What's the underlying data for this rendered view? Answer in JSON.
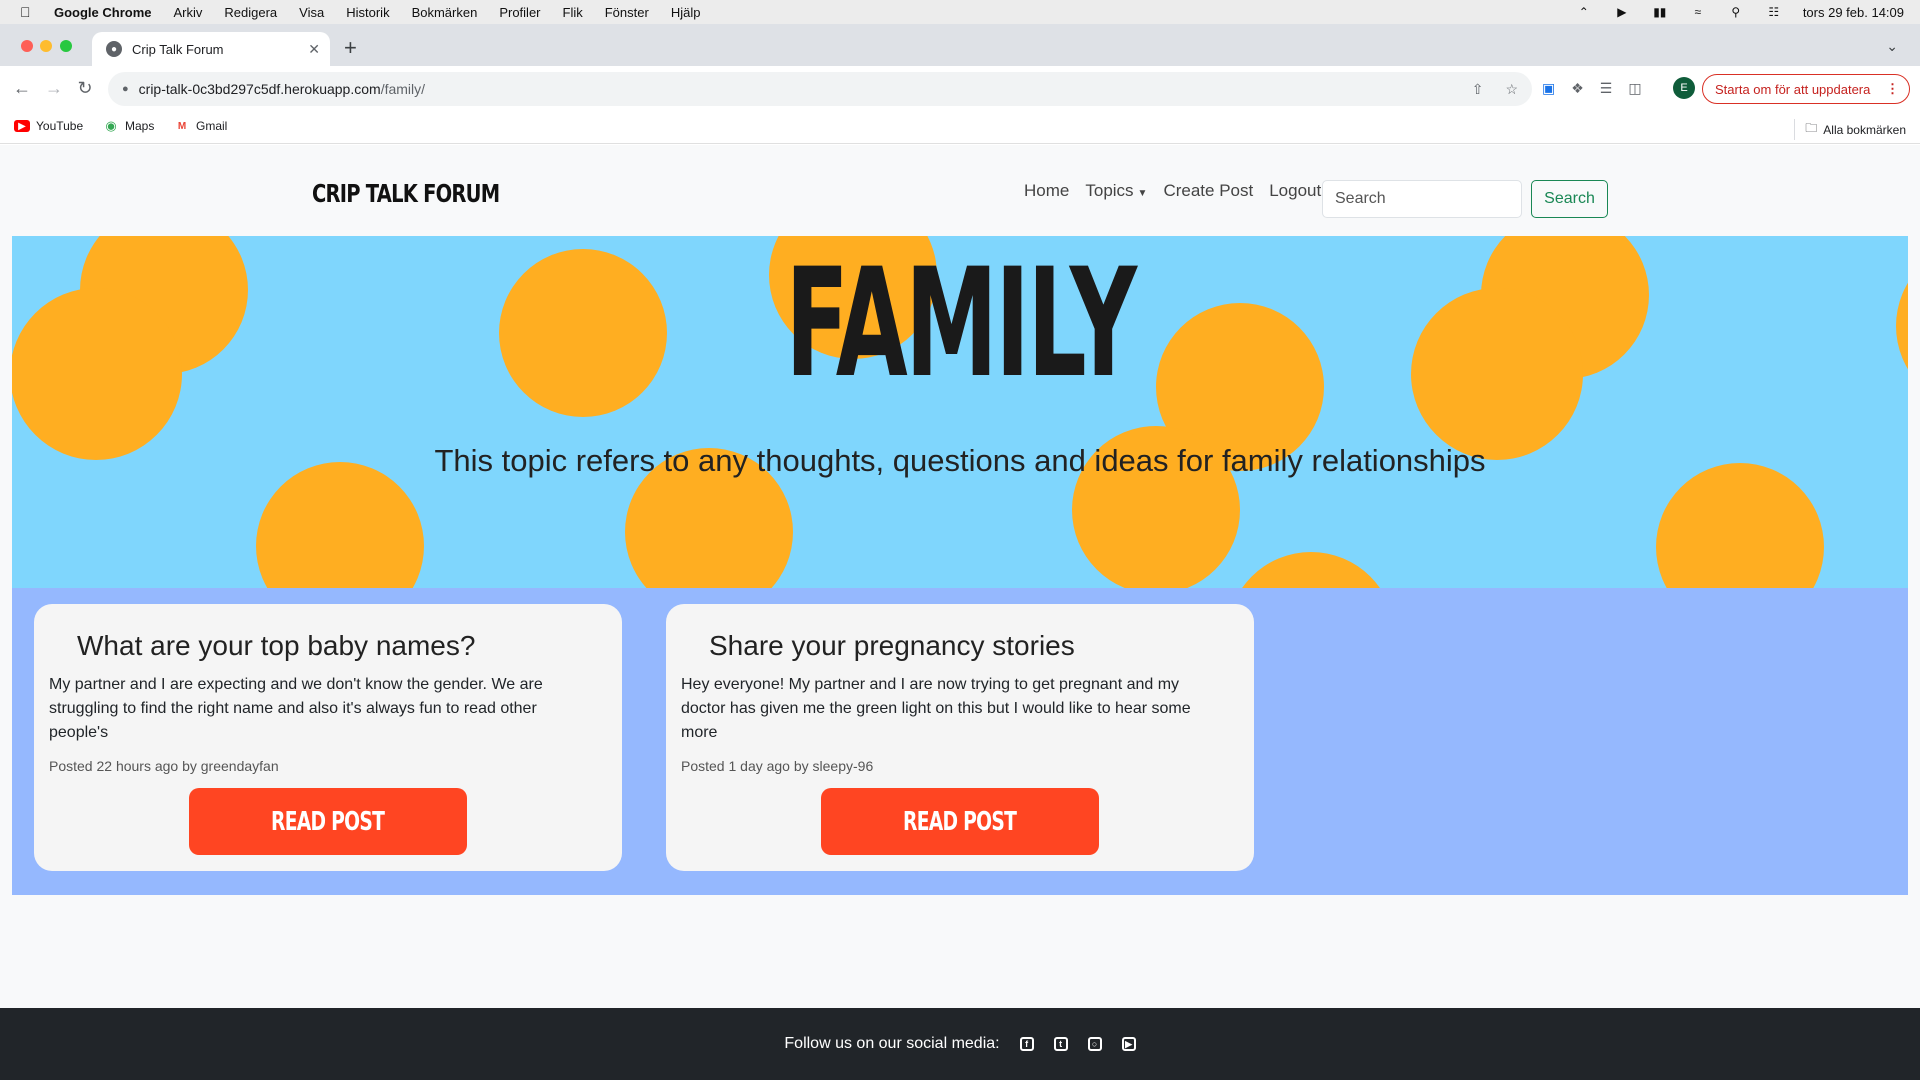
{
  "os_menubar": {
    "app_name": "Google Chrome",
    "items": [
      "Arkiv",
      "Redigera",
      "Visa",
      "Historik",
      "Bokmärken",
      "Profiler",
      "Flik",
      "Fönster",
      "Hjälp"
    ],
    "clock": "tors 29 feb. 14:09"
  },
  "browser": {
    "tab_title": "Crip Talk Forum",
    "url_host": "crip-talk-0c3bd297c5df.herokuapp.com",
    "url_path": "/family/",
    "profile_initial": "E",
    "update_label": "Starta om för att uppdatera",
    "bookmarks": [
      "YouTube",
      "Maps",
      "Gmail"
    ],
    "all_bookmarks_label": "Alla bokmärken"
  },
  "site": {
    "brand": "CRIP TALK FORUM",
    "nav": {
      "home": "Home",
      "topics": "Topics",
      "create_post": "Create Post",
      "logout": "Logout"
    },
    "search_placeholder": "Search",
    "search_button": "Search"
  },
  "hero": {
    "title": "FAMILY",
    "subtitle": "This topic refers to any thoughts, questions and ideas for family relationships"
  },
  "posts": [
    {
      "title": "What are your top baby names?",
      "excerpt": "My partner and I are expecting and we don't know the gender. We are struggling to find the right name and also it's always fun to read other people's",
      "meta": "Posted 22 hours ago by greendayfan",
      "button": "READ POST"
    },
    {
      "title": "Share your pregnancy stories",
      "excerpt": "Hey everyone! My partner and I are now trying to get pregnant and my doctor has given me the green light on this but I would like to hear some more",
      "meta": "Posted 1 day ago by sleepy-96",
      "button": "READ POST"
    }
  ],
  "footer": {
    "text": "Follow us on our social media:",
    "icons": [
      "facebook-icon",
      "twitter-icon",
      "instagram-icon",
      "youtube-icon"
    ]
  },
  "colors": {
    "hero_bg": "#7fd6fd",
    "dots": "#ffae21",
    "posts_bg": "#95b8fe",
    "button": "#ff4522",
    "footer_bg": "#212529",
    "search_green": "#198754"
  }
}
